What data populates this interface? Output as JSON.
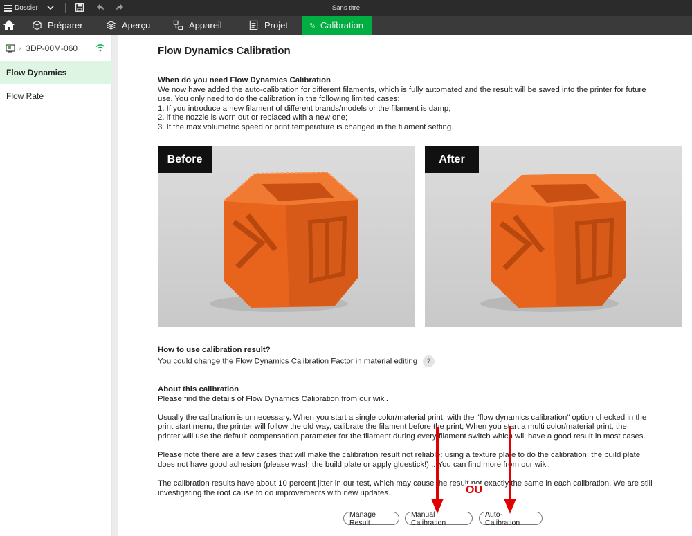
{
  "titlebar": {
    "menu_label": "Dossier",
    "window_title": "Sans titre"
  },
  "tabs": [
    {
      "label": "Préparer",
      "icon": "cube-outline-icon"
    },
    {
      "label": "Aperçu",
      "icon": "layers-icon"
    },
    {
      "label": "Appareil",
      "icon": "device-icon"
    },
    {
      "label": "Projet",
      "icon": "document-icon"
    },
    {
      "label": "Calibration",
      "icon": "calibration-icon",
      "active": true
    }
  ],
  "sidebar": {
    "device_name": "3DP-00M-060",
    "items": [
      {
        "label": "Flow Dynamics",
        "active": true
      },
      {
        "label": "Flow Rate",
        "active": false
      }
    ]
  },
  "main": {
    "title": "Flow Dynamics Calibration",
    "when": {
      "heading": "When do you need Flow Dynamics Calibration",
      "line1": "We now have added the auto-calibration for different filaments, which is fully automated and the result will be saved into the printer for future",
      "line2": "use. You only need to do the calibration in the following limited cases:",
      "line3": "1. If you introduce a new filament of different brands/models or the filament is damp;",
      "line4": "2. if the nozzle is worn out or replaced with a new one;",
      "line5": "3. If the max volumetric speed or print temperature is changed in the filament setting."
    },
    "photos": {
      "before_label": "Before",
      "after_label": "After"
    },
    "how": {
      "heading": "How to use calibration result?",
      "text": "You could change the Flow Dynamics Calibration Factor in material editing",
      "help": "?"
    },
    "about": {
      "heading": "About this calibration",
      "text": "Please find the details of Flow Dynamics Calibration from our wiki.",
      "p1_l1": "Usually the calibration is unnecessary. When you start a single color/material print, with the \"flow dynamics calibration\" option checked in the",
      "p1_l2": "print start menu, the printer will follow the old way, calibrate the filament before the print; When you start a multi color/material print, the",
      "p1_l3": "printer will use the default compensation parameter for the filament during every filament switch which will have a good result in most cases.",
      "p2_l1": "Please note there are a few cases that will make the calibration result not reliable: using a texture plate to do the calibration; the build plate",
      "p2_l2": "does not have good adhesion (please wash the build plate or apply gluestick!) ...You can find more from our wiki.",
      "p3_l1": "The calibration results have about 10 percent jitter in our test, which may cause the result not exactly the same in each calibration. We are still",
      "p3_l2": "investigating the root cause to do improvements with new updates."
    },
    "buttons": {
      "manage": "Manage Result",
      "manual": "Manual Calibration",
      "auto": "Auto-Calibration"
    },
    "annotation": "OU"
  },
  "colors": {
    "accent": "#00ae42",
    "active_item_bg": "#dff5e4",
    "annotation_red": "#e00000",
    "cube_orange": "#e8641d"
  }
}
